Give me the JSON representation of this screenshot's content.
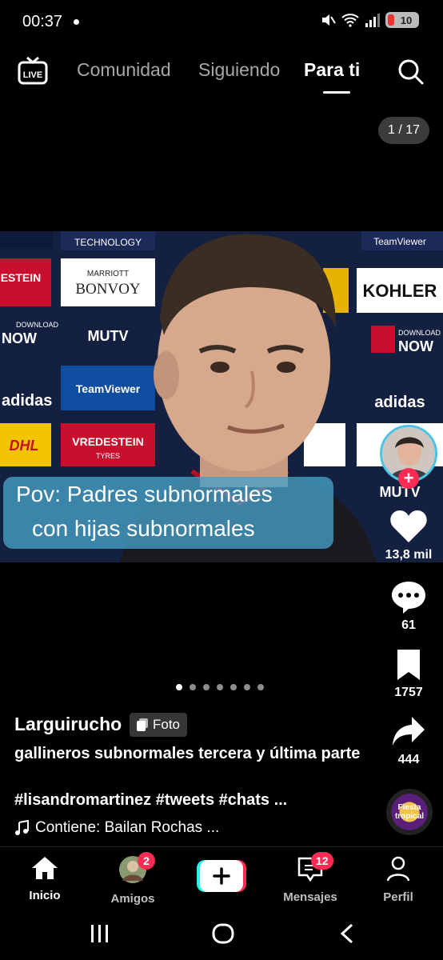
{
  "status": {
    "time": "00:37",
    "battery": "10"
  },
  "topnav": {
    "tabs": [
      "Comunidad",
      "Siguiendo",
      "Para ti"
    ],
    "active_tab": "Para ti"
  },
  "post": {
    "counter": "1 / 17",
    "caption_line1": "Pov: Padres subnormales",
    "caption_line2": "con hijas subnormales",
    "author": "Larguirucho",
    "type_tag": "Foto",
    "description": "gallineros subnormales tercera y última parte",
    "hashtags": "#lisandromartinez #tweets #chats ...",
    "music": "Contiene: Bailan Rochas ...",
    "page_dots_total": 7,
    "page_dots_active": 1,
    "backdrop_text": [
      "TECHNOLOGY",
      "MARRIOTT",
      "BONVOY",
      "KOHLER",
      "MUTV",
      "TeamViewer",
      "adidas",
      "VREDESTEIN",
      "TYRES",
      "DOWNLOAD",
      "NOW",
      "ESTEIN",
      "DHL",
      "MUTV"
    ]
  },
  "rail": {
    "likes": "13,8 mil",
    "comments": "61",
    "saves": "1757",
    "shares": "444",
    "disc_label": "Fiesta tropical"
  },
  "bottomnav": {
    "home": "Inicio",
    "friends": "Amigos",
    "friends_badge": "2",
    "messages": "Mensajes",
    "messages_badge": "12",
    "profile": "Perfil"
  },
  "colors": {
    "accent": "#fe2c55",
    "cyan": "#25f4ee",
    "caption_bg": "#46a0c8"
  }
}
